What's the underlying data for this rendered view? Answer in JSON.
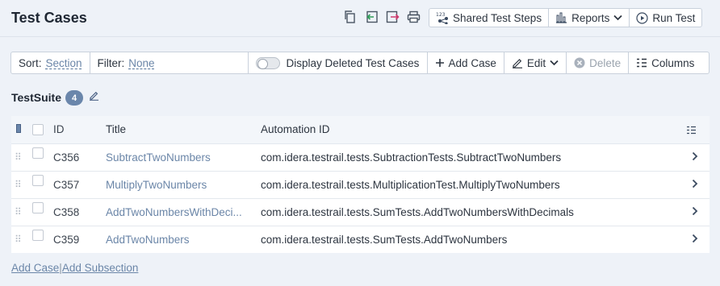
{
  "header": {
    "title": "Test Cases",
    "icons": [
      "copy-icon",
      "import-icon",
      "export-icon",
      "print-icon"
    ],
    "buttons": {
      "shared_steps": "Shared Test Steps",
      "reports": "Reports",
      "run_test": "Run Test"
    }
  },
  "toolbar": {
    "sort_label": "Sort:",
    "sort_value": "Section",
    "filter_label": "Filter:",
    "filter_value": "None",
    "display_deleted": "Display Deleted Test Cases",
    "add_case": "Add Case",
    "edit": "Edit",
    "delete": "Delete",
    "columns": "Columns"
  },
  "suite": {
    "name": "TestSuite",
    "count": "4"
  },
  "table": {
    "headers": {
      "id": "ID",
      "title": "Title",
      "automation_id": "Automation ID"
    },
    "rows": [
      {
        "id": "C356",
        "title": "SubtractTwoNumbers",
        "automation_id": "com.idera.testrail.tests.SubtractionTests.SubtractTwoNumbers"
      },
      {
        "id": "C357",
        "title": "MultiplyTwoNumbers",
        "automation_id": "com.idera.testrail.tests.MultiplicationTest.MultiplyTwoNumbers"
      },
      {
        "id": "C358",
        "title": "AddTwoNumbersWithDeci...",
        "automation_id": "com.idera.testrail.tests.SumTests.AddTwoNumbersWithDecimals"
      },
      {
        "id": "C359",
        "title": "AddTwoNumbers",
        "automation_id": "com.idera.testrail.tests.SumTests.AddTwoNumbers"
      }
    ]
  },
  "footer": {
    "add_case": "Add Case",
    "separator": "|",
    "add_subsection": "Add Subsection"
  }
}
